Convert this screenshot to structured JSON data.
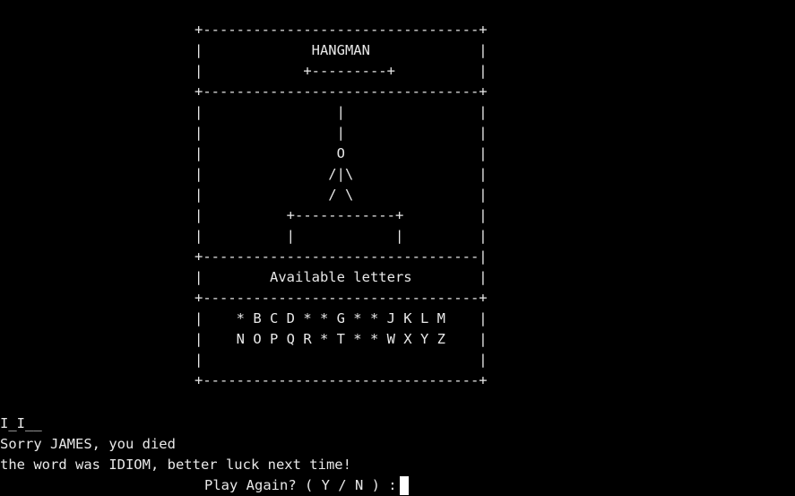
{
  "frame": {
    "lines": [
      "+---------------------------------+",
      "|             HANGMAN             |",
      "|            +---------+          |",
      "+---------------------------------+",
      "|                |                |",
      "|                |                |",
      "|                O                |",
      "|               /|\\               |",
      "|               / \\               |",
      "|          +------------+         |",
      "|          |            |         |",
      "+---------------------------------|",
      "|        Available letters        |",
      "+---------------------------------+",
      "|    * B C D * * G * * J K L M    |",
      "|    N O P Q R * T * * W X Y Z    |",
      "|                                 |",
      "+---------------------------------+"
    ]
  },
  "status": {
    "word_progress": "I_I__",
    "death_message": "Sorry JAMES, you died",
    "reveal_message": "the word was IDIOM, better luck next time!"
  },
  "prompt": {
    "text": "Play Again? ( Y / N ) :"
  }
}
